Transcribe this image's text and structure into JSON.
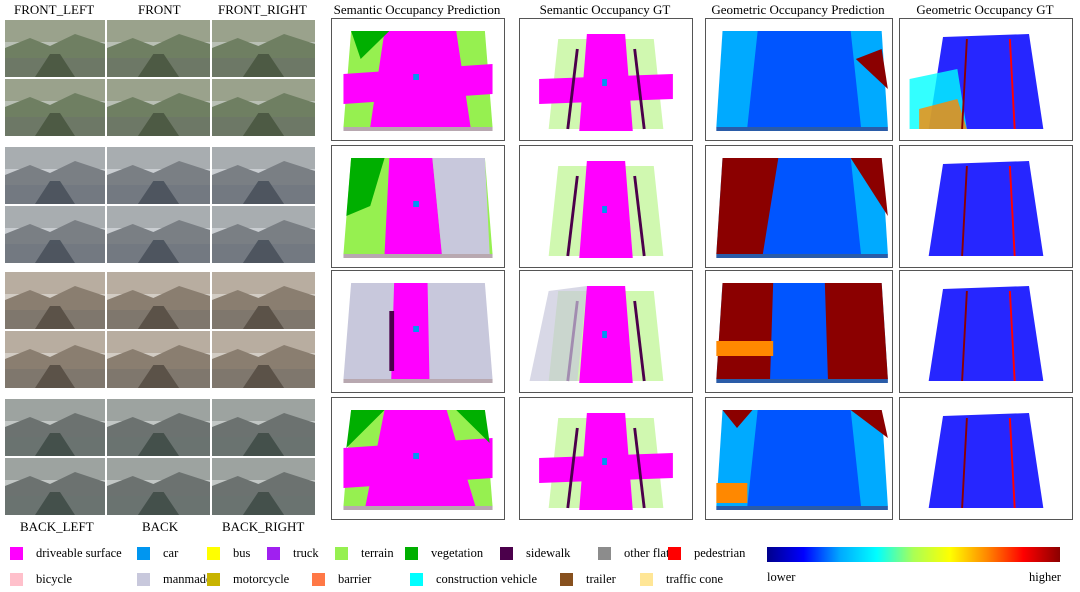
{
  "camera_labels": {
    "front_left": "FRONT_LEFT",
    "front": "FRONT",
    "front_right": "FRONT_RIGHT",
    "back_left": "BACK_LEFT",
    "back": "BACK",
    "back_right": "BACK_RIGHT"
  },
  "column_headers": {
    "sem_pred": "Semantic Occupancy Prediction",
    "sem_gt": "Semantic Occupancy GT",
    "geo_pred": "Geometric Occupancy Prediction",
    "geo_gt": "Geometric Occupancy GT"
  },
  "legend": [
    {
      "label": "driveable surface",
      "color": "#ff00ff"
    },
    {
      "label": "car",
      "color": "#0096f0"
    },
    {
      "label": "bus",
      "color": "#ffff00"
    },
    {
      "label": "truck",
      "color": "#a020f0"
    },
    {
      "label": "terrain",
      "color": "#96f050"
    },
    {
      "label": "vegetation",
      "color": "#00af00"
    },
    {
      "label": "sidewalk",
      "color": "#4b004b"
    },
    {
      "label": "other flat",
      "color": "#8c8c8c"
    },
    {
      "label": "pedestrian",
      "color": "#ff0000"
    },
    {
      "label": "bicycle",
      "color": "#ffc0cb"
    },
    {
      "label": "manmade",
      "color": "#c8c8dc"
    },
    {
      "label": "motorcycle",
      "color": "#c8b400"
    },
    {
      "label": "barrier",
      "color": "#ff7846"
    },
    {
      "label": "construction vehicle",
      "color": "#00ffff"
    },
    {
      "label": "trailer",
      "color": "#87501e"
    },
    {
      "label": "traffic cone",
      "color": "#ffe696"
    }
  ],
  "colorbar": {
    "low_label": "lower",
    "high_label": "higher",
    "colors": [
      "#00008b",
      "#0000ff",
      "#00aaff",
      "#00ffff",
      "#aaff55",
      "#ffff00",
      "#ff8800",
      "#ff0000",
      "#8b0000"
    ]
  }
}
